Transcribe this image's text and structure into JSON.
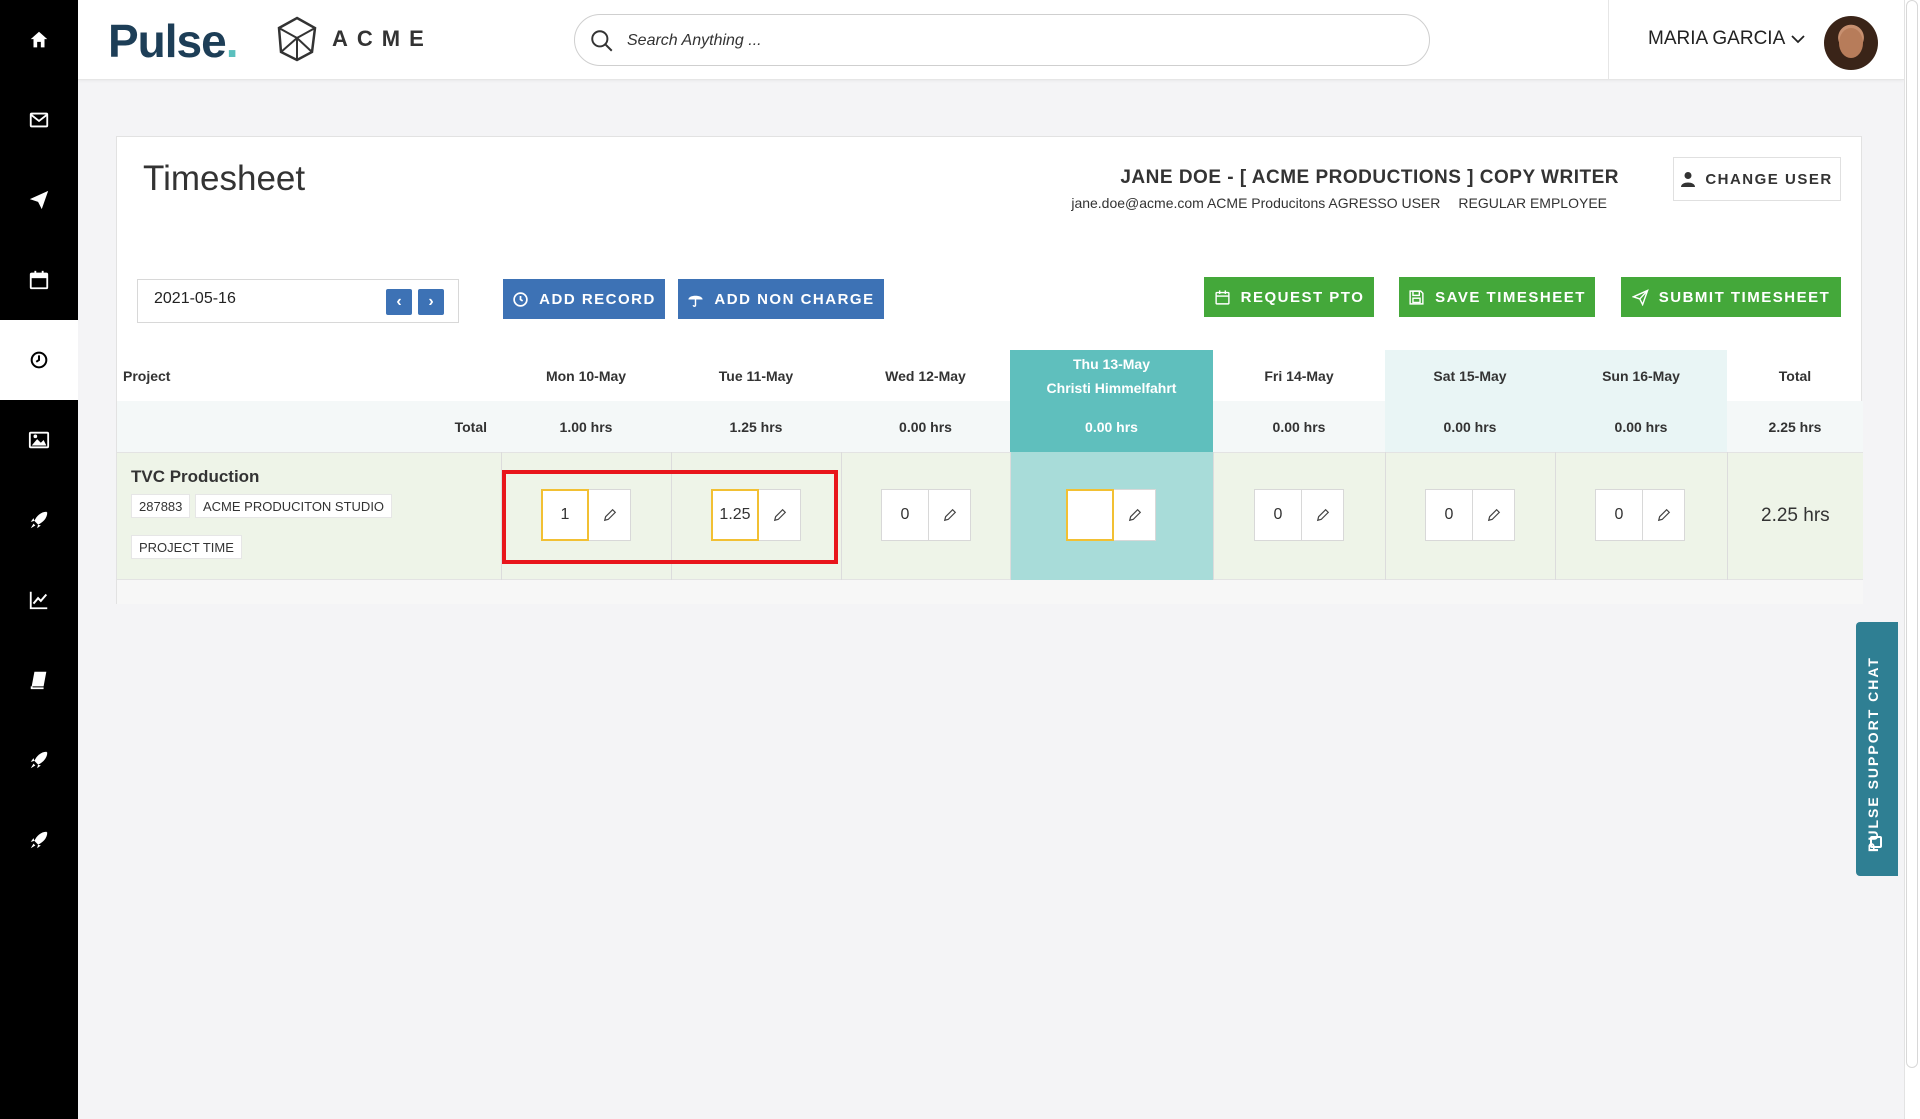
{
  "header": {
    "brand_pulse": "Pulse",
    "brand_acme": "ACME",
    "search_placeholder": "Search Anything ...",
    "user_name": "MARIA GARCIA"
  },
  "sidebar": {
    "items": [
      {
        "icon": "home-icon"
      },
      {
        "icon": "mail-icon"
      },
      {
        "icon": "send-icon"
      },
      {
        "icon": "calendar-icon"
      },
      {
        "icon": "clock-icon",
        "active": true
      },
      {
        "icon": "image-icon"
      },
      {
        "icon": "rocket-icon"
      },
      {
        "icon": "chart-icon"
      },
      {
        "icon": "book-icon"
      },
      {
        "icon": "rocket-icon"
      },
      {
        "icon": "rocket-icon"
      }
    ]
  },
  "timesheet": {
    "title": "Timesheet",
    "employee_name": "JANE DOE - [ ACME PRODUCTIONS ] COPY WRITER",
    "employee_email": "jane.doe@acme.com",
    "employee_company": "ACME Producitons AGRESSO USER",
    "employee_type": "REGULAR EMPLOYEE",
    "change_user_label": "CHANGE USER",
    "date_value": "2021-05-16",
    "prev_label": "‹",
    "next_label": "›",
    "add_record_label": "ADD RECORD",
    "add_non_charge_label": "ADD NON CHARGE",
    "request_pto_label": "REQUEST PTO",
    "save_label": "SAVE TIMESHEET",
    "submit_label": "SUBMIT TIMESHEET"
  },
  "table": {
    "project_header": "Project",
    "total_header": "Total",
    "total_row_label": "Total",
    "days": [
      {
        "label": "Mon 10-May",
        "total": "1.00 hrs"
      },
      {
        "label": "Tue 11-May",
        "total": "1.25 hrs"
      },
      {
        "label": "Wed 12-May",
        "total": "0.00 hrs"
      },
      {
        "label": "Thu 13-May",
        "sublabel": "Christi Himmelfahrt",
        "total": "0.00 hrs"
      },
      {
        "label": "Fri 14-May",
        "total": "0.00 hrs"
      },
      {
        "label": "Sat 15-May",
        "total": "0.00 hrs"
      },
      {
        "label": "Sun 16-May",
        "total": "0.00 hrs"
      }
    ],
    "grand_total": "2.25 hrs",
    "row": {
      "project_name": "TVC Production",
      "project_code": "287883",
      "studio": "ACME PRODUCITON STUDIO",
      "category": "PROJECT TIME",
      "hours": [
        "1",
        "1.25",
        "0",
        "",
        "0",
        "0",
        "0"
      ],
      "total": "2.25 hrs"
    }
  },
  "support_chat": {
    "label": "PULSE SUPPORT CHAT"
  },
  "colors": {
    "primary_blue": "#3d72b5",
    "action_green": "#44a83a",
    "holiday_teal": "#5fbfbd",
    "highlight_red": "#e8151b",
    "brand_navy": "#1d3e57"
  }
}
